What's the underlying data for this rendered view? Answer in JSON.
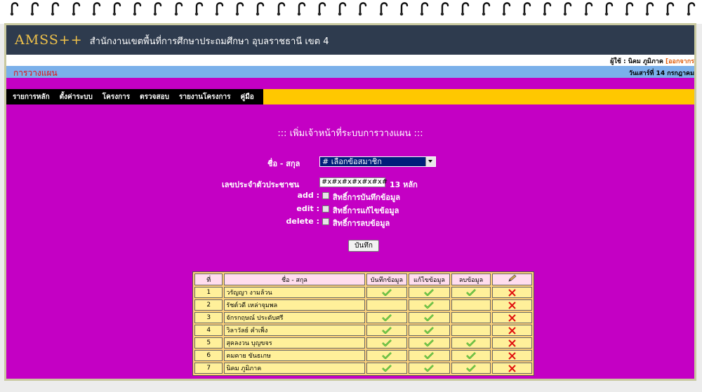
{
  "header": {
    "app_name": "AMSS++",
    "org_name": "สำนักงานเขตพื้นที่การศึกษาประถมศึกษา อุบลราชธานี เขต 4",
    "user_label": "ผู้ใช้ : นิคม ภูมิภาค",
    "logout_label": "[ออกจากร",
    "module_name": "การวางแผน",
    "date_text": "วันเสาร์ที่ 14 กรกฎาคม"
  },
  "menu": [
    "รายการหลัก",
    "ตั้งค่าระบบ",
    "โครงการ",
    "ตรวจสอบ",
    "รายงานโครงการ",
    "คู่มือ"
  ],
  "form": {
    "title": "::: เพิ่มเจ้าหน้าที่ระบบการวางแผน :::",
    "name_label": "ชื่อ - สกุล",
    "name_select_value": "# เลือกข้อสมาชิก",
    "id_label": "เลขประจำตัวประชาชน",
    "id_value": "#x#x#x#x#x#x#",
    "id_hint": "13 หลัก",
    "add_label": "add :",
    "add_desc": "สิทธิ์การบันทึกข้อมูล",
    "edit_label": "edit :",
    "edit_desc": "สิทธิ์การแก้ไขข้อมูล",
    "delete_label": "delete :",
    "delete_desc": "สิทธิ์การลบข้อมูล",
    "save_label": "บันทึก"
  },
  "table": {
    "headers": [
      "ที่",
      "ชื่อ - สกุล",
      "บันทึกข้อมูล",
      "แก้ไขข้อมูล",
      "ลบข้อมูล",
      "edit-icon"
    ],
    "rows": [
      {
        "no": "1",
        "name": "วรัญญา งามล้วน",
        "add": true,
        "edit": true,
        "delete": true
      },
      {
        "no": "2",
        "name": "รัชต์วดี เหล่าจุมพล",
        "add": false,
        "edit": true,
        "delete": false
      },
      {
        "no": "3",
        "name": "จักรกฤษณ์ ประดับศรี",
        "add": true,
        "edit": true,
        "delete": false
      },
      {
        "no": "4",
        "name": "วิลาวัลย์ คำเพ็ง",
        "add": true,
        "edit": true,
        "delete": false
      },
      {
        "no": "5",
        "name": "สุคลงวน บุญขจร",
        "add": true,
        "edit": true,
        "delete": true
      },
      {
        "no": "6",
        "name": "คมคาย ขันธเกษ",
        "add": true,
        "edit": true,
        "delete": true
      },
      {
        "no": "7",
        "name": "นิคม ภูมิภาค",
        "add": true,
        "edit": true,
        "delete": true
      }
    ]
  },
  "colors": {
    "page_bg": "#c400c4",
    "header_bg": "#2e3b4e",
    "menu_bar": "#ffc800",
    "sub_bar": "#7ab0ea"
  }
}
